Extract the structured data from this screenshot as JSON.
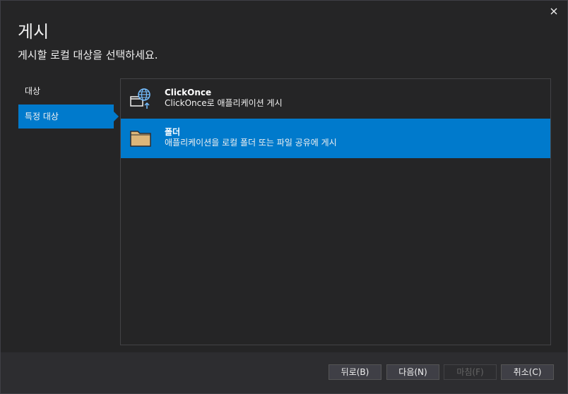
{
  "dialog": {
    "title": "게시",
    "subtitle": "게시할 로컬 대상을 선택하세요."
  },
  "sidebar": {
    "items": [
      {
        "label": "대상",
        "active": false
      },
      {
        "label": "특정 대상",
        "active": true
      }
    ]
  },
  "options": [
    {
      "title": "ClickOnce",
      "description": "ClickOnce로 애플리케이션 게시",
      "icon": "clickonce-globe-icon",
      "selected": false
    },
    {
      "title": "폴더",
      "description": "애플리케이션을 로컬 폴더 또는 파일 공유에 게시",
      "icon": "folder-icon",
      "selected": true
    }
  ],
  "footer": {
    "back_label": "뒤로(B)",
    "next_label": "다음(N)",
    "finish_label": "마침(F)",
    "cancel_label": "취소(C)"
  },
  "colors": {
    "accent": "#007acc",
    "background": "#252526",
    "footer": "#2d2d30",
    "folder": "#dcb67a"
  }
}
